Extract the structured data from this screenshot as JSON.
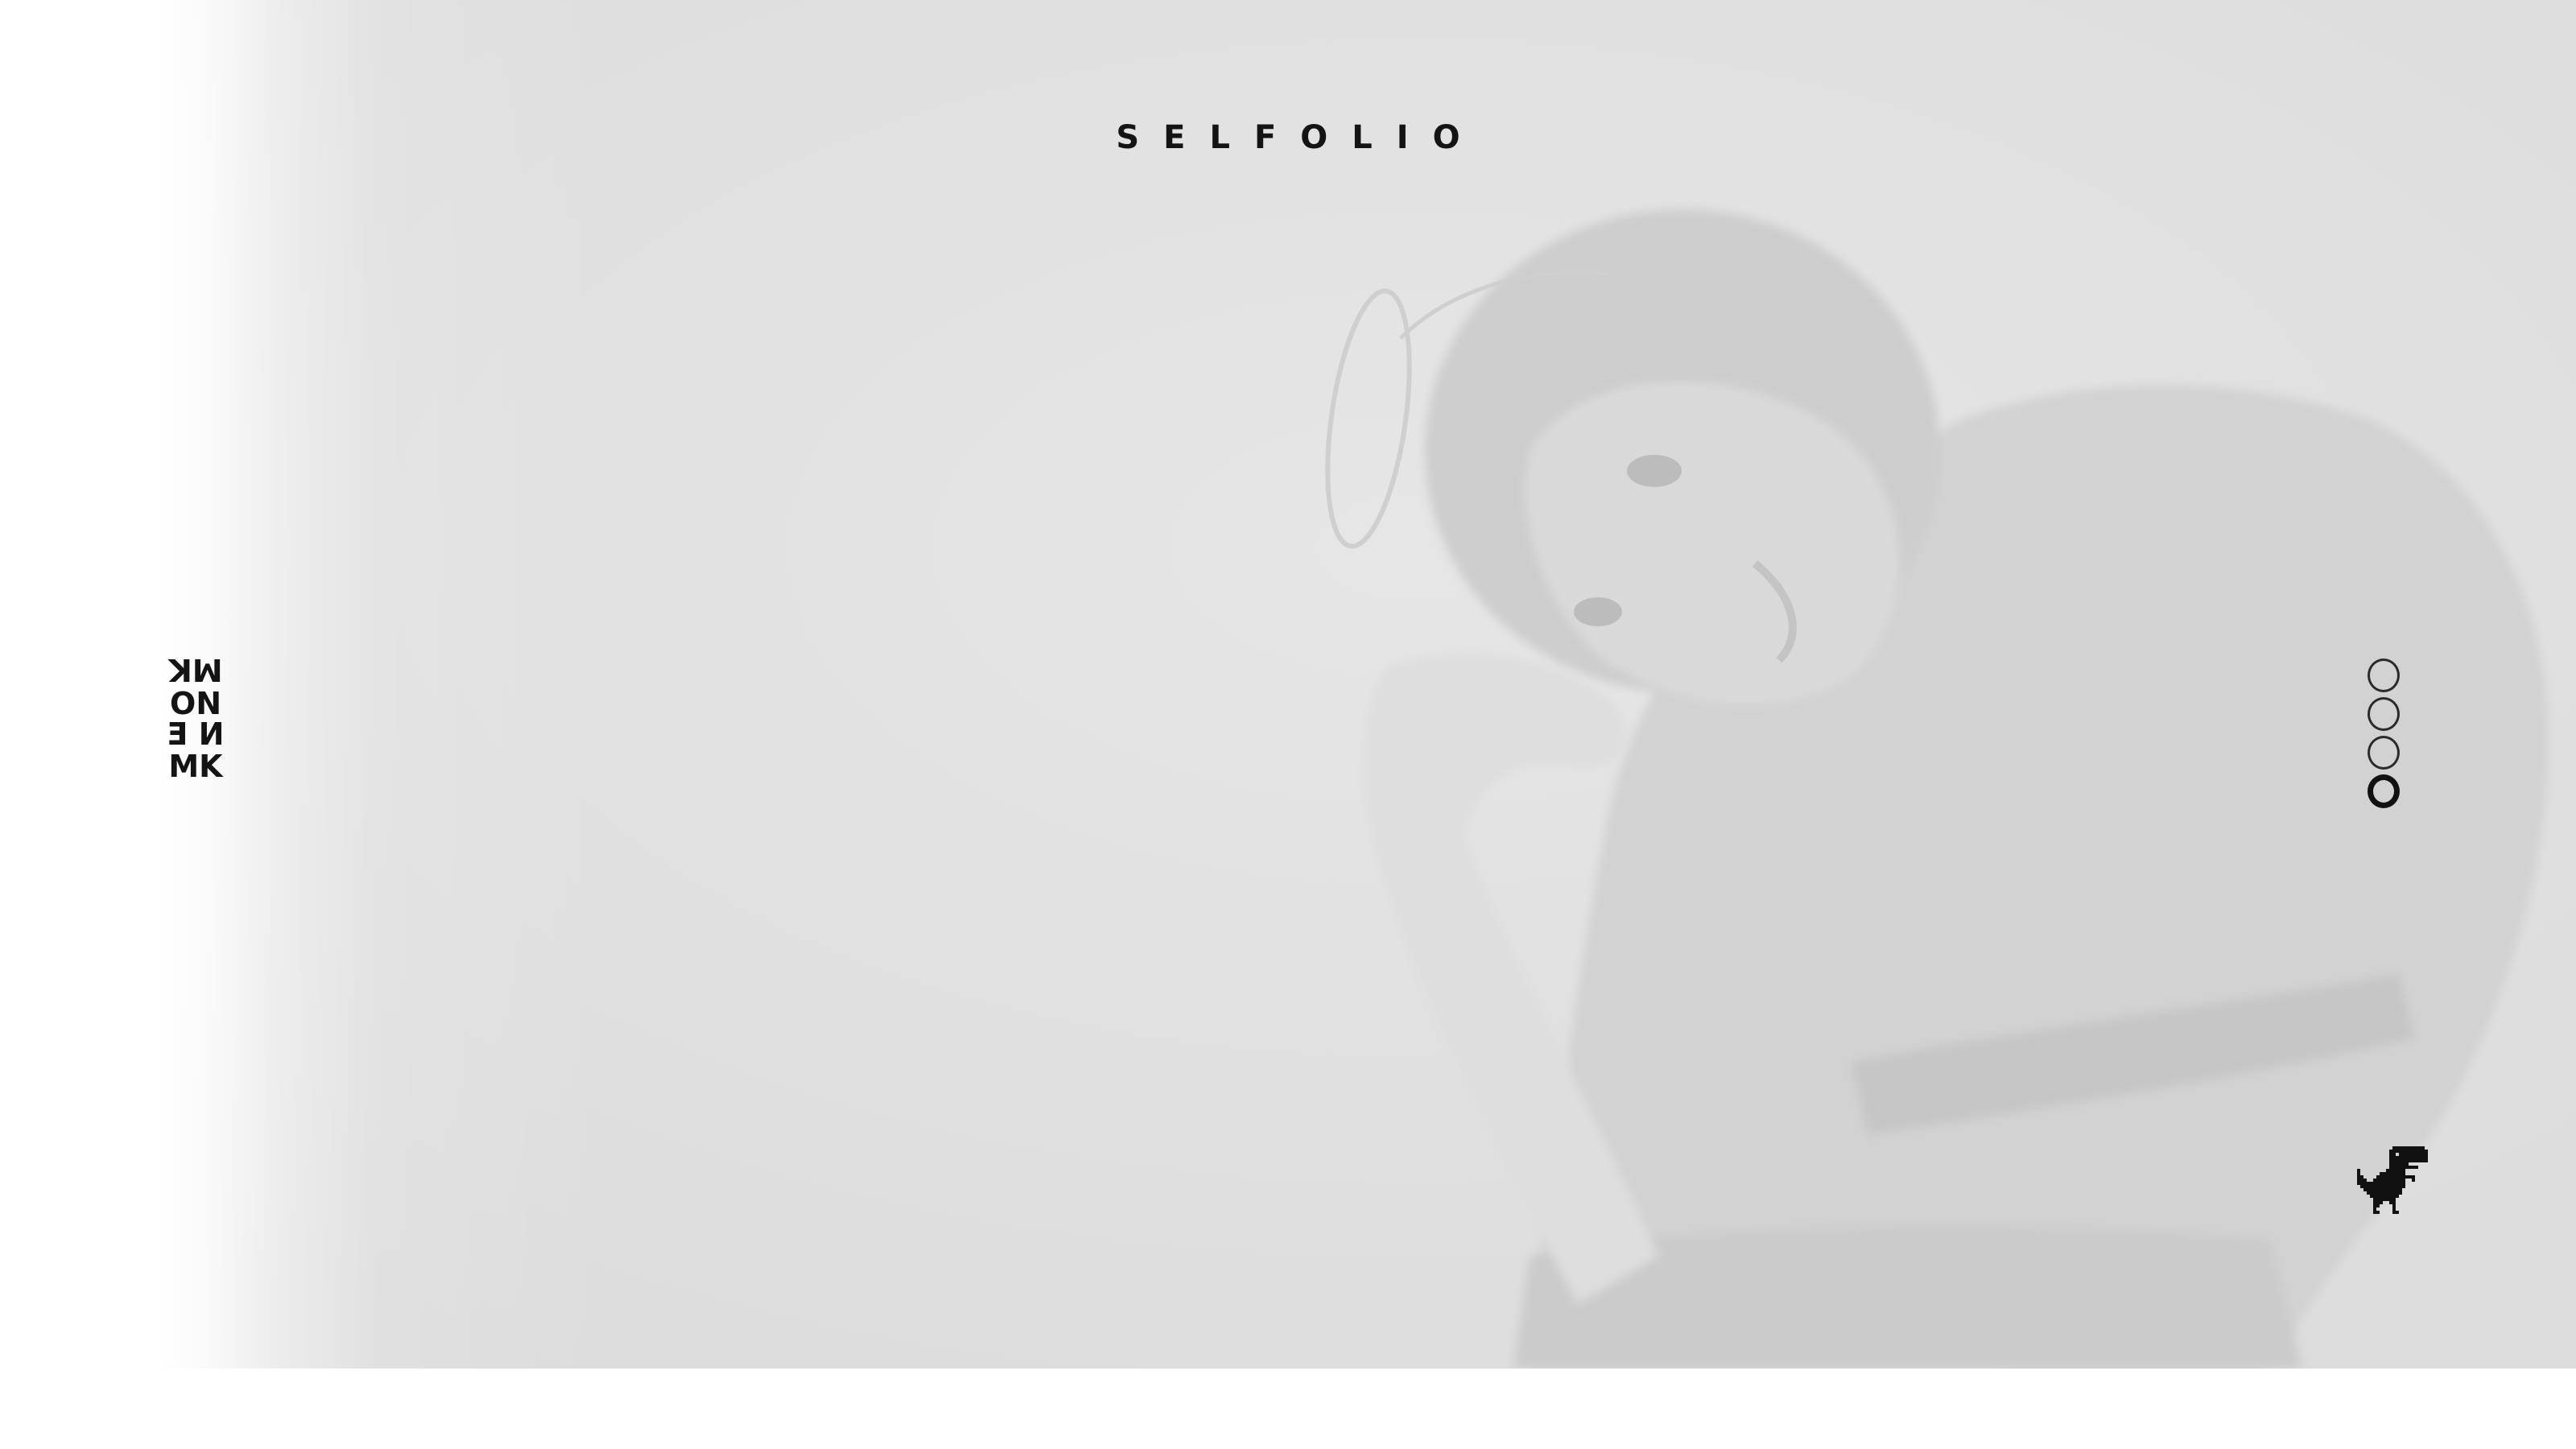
{
  "site": {
    "title": "SELFOLIO",
    "side_logo_text": "MKONE MK"
  },
  "hero": {
    "image_description_icon": "portrait-photo"
  },
  "slider": {
    "total_slides": 4,
    "active_slide": 4
  },
  "icons": {
    "dino": "dino-icon",
    "dot": "dot-icon"
  },
  "colors": {
    "background": "#e0e0e0",
    "text": "#141414",
    "page": "#ffffff"
  }
}
